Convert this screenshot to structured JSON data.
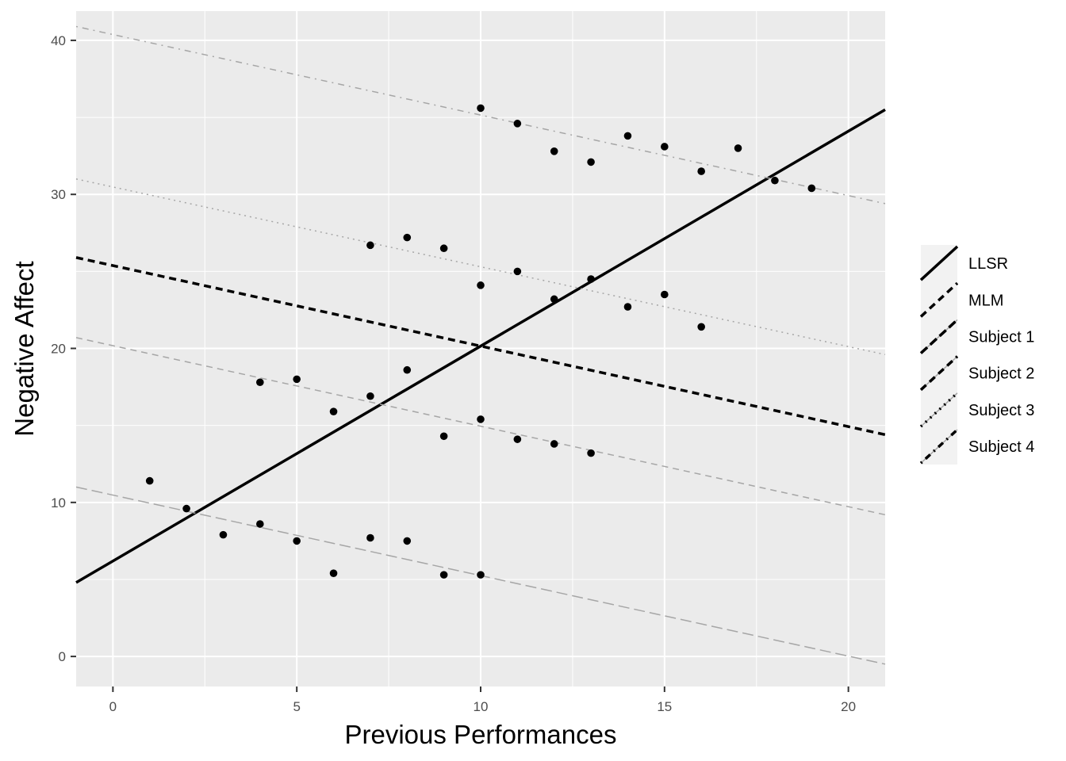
{
  "chart_data": {
    "type": "scatter",
    "title": "",
    "xlabel": "Previous Performances",
    "ylabel": "Negative Affect",
    "xlim": [
      -1,
      21
    ],
    "ylim": [
      -1.95,
      41.9
    ],
    "xticks": [
      0,
      5,
      10,
      15,
      20
    ],
    "yticks": [
      0,
      10,
      20,
      30,
      40
    ],
    "xminor": [
      2.5,
      7.5,
      12.5,
      17.5
    ],
    "yminor": [
      5,
      15,
      25,
      35
    ],
    "grid": true,
    "panel_background": "#ebebeb",
    "points": [
      {
        "x": 1,
        "y": 11.4
      },
      {
        "x": 2,
        "y": 9.6
      },
      {
        "x": 3,
        "y": 7.9
      },
      {
        "x": 4,
        "y": 8.6
      },
      {
        "x": 5,
        "y": 7.5
      },
      {
        "x": 6,
        "y": 5.4
      },
      {
        "x": 7,
        "y": 7.7
      },
      {
        "x": 8,
        "y": 7.5
      },
      {
        "x": 9,
        "y": 5.3
      },
      {
        "x": 10,
        "y": 5.3
      },
      {
        "x": 4,
        "y": 17.8
      },
      {
        "x": 5,
        "y": 18.0
      },
      {
        "x": 6,
        "y": 15.9
      },
      {
        "x": 7,
        "y": 16.9
      },
      {
        "x": 8,
        "y": 18.6
      },
      {
        "x": 9,
        "y": 14.3
      },
      {
        "x": 10,
        "y": 15.4
      },
      {
        "x": 11,
        "y": 14.1
      },
      {
        "x": 12,
        "y": 13.8
      },
      {
        "x": 13,
        "y": 13.2
      },
      {
        "x": 7,
        "y": 26.7
      },
      {
        "x": 8,
        "y": 27.2
      },
      {
        "x": 9,
        "y": 26.5
      },
      {
        "x": 10,
        "y": 24.1
      },
      {
        "x": 11,
        "y": 25.0
      },
      {
        "x": 12,
        "y": 23.2
      },
      {
        "x": 13,
        "y": 24.5
      },
      {
        "x": 14,
        "y": 22.7
      },
      {
        "x": 15,
        "y": 23.5
      },
      {
        "x": 16,
        "y": 21.4
      },
      {
        "x": 10,
        "y": 35.6
      },
      {
        "x": 11,
        "y": 34.6
      },
      {
        "x": 12,
        "y": 32.8
      },
      {
        "x": 13,
        "y": 32.1
      },
      {
        "x": 14,
        "y": 33.8
      },
      {
        "x": 15,
        "y": 33.1
      },
      {
        "x": 16,
        "y": 31.5
      },
      {
        "x": 17,
        "y": 33.0
      },
      {
        "x": 18,
        "y": 30.9
      },
      {
        "x": 19,
        "y": 30.4
      }
    ],
    "series": [
      {
        "name": "LLSR",
        "x": [
          -1,
          21
        ],
        "y": [
          4.8,
          35.5
        ],
        "color": "#000000",
        "dash": "solid",
        "weight": "thick"
      },
      {
        "name": "MLM",
        "x": [
          -1,
          21
        ],
        "y": [
          25.9,
          14.4
        ],
        "color": "#000000",
        "dash": "dashed",
        "weight": "thick"
      },
      {
        "name": "Subject 1",
        "x": [
          -1,
          21
        ],
        "y": [
          11.0,
          -0.5
        ],
        "color": "#a6a6a6",
        "dash": "longdash",
        "weight": "thin"
      },
      {
        "name": "Subject 2",
        "x": [
          -1,
          21
        ],
        "y": [
          20.7,
          9.2
        ],
        "color": "#a6a6a6",
        "dash": "dashed",
        "weight": "thin"
      },
      {
        "name": "Subject 3",
        "x": [
          -1,
          21
        ],
        "y": [
          31.0,
          19.6
        ],
        "color": "#a6a6a6",
        "dash": "dotted",
        "weight": "thin"
      },
      {
        "name": "Subject 4",
        "x": [
          -1,
          21
        ],
        "y": [
          40.9,
          29.4
        ],
        "color": "#a6a6a6",
        "dash": "dotdash",
        "weight": "thin"
      }
    ],
    "legend": {
      "position": "right",
      "entries": [
        "LLSR",
        "MLM",
        "Subject 1",
        "Subject 2",
        "Subject 3",
        "Subject 4"
      ]
    }
  }
}
